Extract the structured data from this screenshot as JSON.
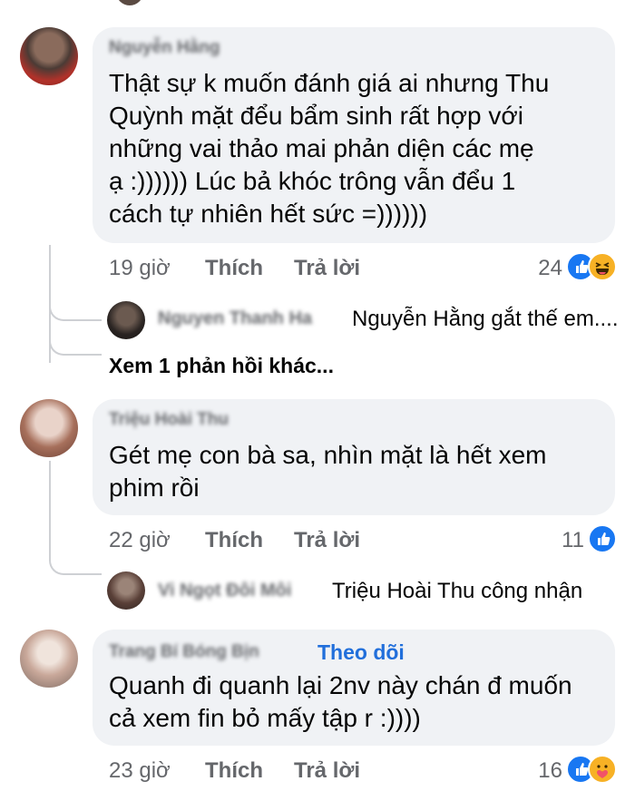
{
  "comments": [
    {
      "author": "Nguyễn Hằng",
      "lines": [
        "Thật sự k muốn đánh giá ai nhưng Thu",
        "Quỳnh mặt đểu bẩm sinh rất hợp với",
        "những vai thảo mai phản diện các mẹ",
        "ạ :)))))) Lúc bả khóc trông vẫn đểu 1",
        "cách tự nhiên hết sức =))))))"
      ],
      "time": "19 giờ",
      "like": "Thích",
      "reply": "Trả lời",
      "reaction_count": "24",
      "reactions": [
        "like-icon",
        "haha-icon"
      ],
      "replies": [
        {
          "name": "Nguyen Thanh Ha",
          "text": "Nguyễn Hằng gắt thế em...."
        }
      ],
      "more_replies": "Xem 1 phản hồi khác..."
    },
    {
      "author": "Triệu Hoài Thu",
      "lines": [
        "Gét mẹ con bà sa, nhìn mặt là hết xem",
        "phim rồi"
      ],
      "time": "22 giờ",
      "like": "Thích",
      "reply": "Trả lời",
      "reaction_count": "11",
      "reactions": [
        "like-icon"
      ],
      "replies": [
        {
          "name": "Vi Ngọt Đôi Môi",
          "text": "Triệu Hoài Thu công nhận"
        }
      ]
    },
    {
      "author": "Trang Bí Bóng Bịn",
      "follow": "Theo dõi",
      "lines": [
        "Quanh đi quanh lại 2nv này chán đ muốn",
        "cả xem fin bỏ mấy tập r :))))"
      ],
      "time": "23 giờ",
      "like": "Thích",
      "reply": "Trả lời",
      "reaction_count": "16",
      "reactions": [
        "like-icon",
        "care-icon"
      ]
    }
  ],
  "colors": {
    "bubble": "#f0f2f5",
    "meta": "#65676b",
    "link": "#216fdb",
    "like": "#1877f2",
    "emoji": "#f7b125"
  }
}
